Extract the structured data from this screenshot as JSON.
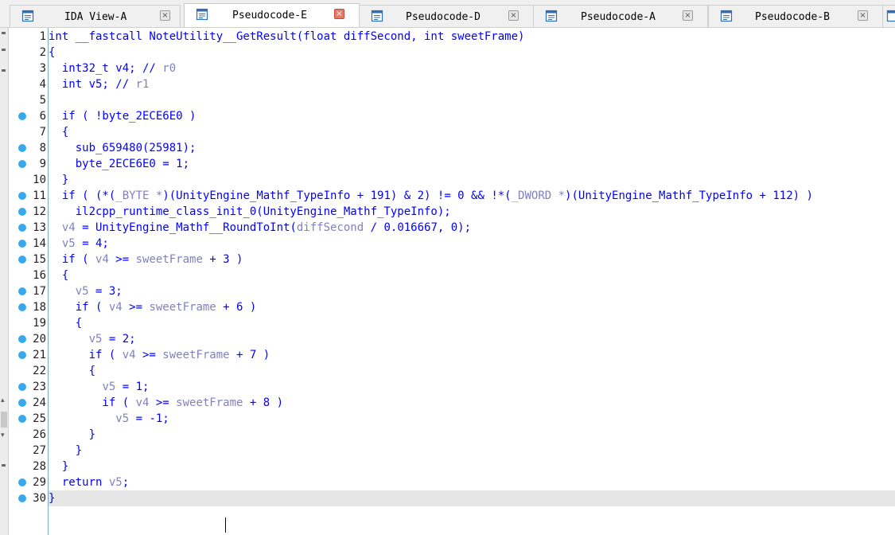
{
  "tabs": [
    {
      "label": "IDA View-A",
      "active": false,
      "close_glyph": "×",
      "icon": "ida-view-icon"
    },
    {
      "label": "Pseudocode-E",
      "active": true,
      "close_glyph": "×",
      "icon": "pseudocode-icon"
    },
    {
      "label": "Pseudocode-D",
      "active": false,
      "close_glyph": "×",
      "icon": "pseudocode-icon"
    },
    {
      "label": "Pseudocode-A",
      "active": false,
      "close_glyph": "×",
      "icon": "pseudocode-icon"
    },
    {
      "label": "Pseudocode-B",
      "active": false,
      "close_glyph": "×",
      "icon": "pseudocode-icon"
    }
  ],
  "colors": {
    "code_text": "#0000ff",
    "variable_gray": "#8080c0",
    "breakpoint_dot": "#35a9ee",
    "active_close": "#e87a6a",
    "current_line_bg": "#e6e6e6",
    "gutter_border": "#7aa9d6"
  },
  "code": {
    "current_line": 30,
    "lines": [
      {
        "n": "1",
        "bp": false,
        "tokens": [
          {
            "t": "int __fastcall NoteUtility__GetResult(float diffSecond, int sweetFrame)",
            "c": "t-k"
          }
        ]
      },
      {
        "n": "2",
        "bp": false,
        "tokens": [
          {
            "t": "{",
            "c": "t-k"
          }
        ]
      },
      {
        "n": "3",
        "bp": false,
        "tokens": [
          {
            "t": "  int32_t v4; // ",
            "c": "t-b"
          },
          {
            "t": "r0",
            "c": "t-g"
          }
        ]
      },
      {
        "n": "4",
        "bp": false,
        "tokens": [
          {
            "t": "  int v5; // ",
            "c": "t-b"
          },
          {
            "t": "r1",
            "c": "t-g"
          }
        ]
      },
      {
        "n": "5",
        "bp": false,
        "tokens": [
          {
            "t": "",
            "c": "t-b"
          }
        ]
      },
      {
        "n": "6",
        "bp": true,
        "tokens": [
          {
            "t": "  if ( !byte_2ECE6E0 )",
            "c": "t-b"
          }
        ]
      },
      {
        "n": "7",
        "bp": false,
        "tokens": [
          {
            "t": "  {",
            "c": "t-b"
          }
        ]
      },
      {
        "n": "8",
        "bp": true,
        "tokens": [
          {
            "t": "    sub_659480(25981);",
            "c": "t-b"
          }
        ]
      },
      {
        "n": "9",
        "bp": true,
        "tokens": [
          {
            "t": "    byte_2ECE6E0 = 1;",
            "c": "t-b"
          }
        ]
      },
      {
        "n": "10",
        "bp": false,
        "tokens": [
          {
            "t": "  }",
            "c": "t-b"
          }
        ]
      },
      {
        "n": "11",
        "bp": true,
        "tokens": [
          {
            "t": "  if ( (*(",
            "c": "t-b"
          },
          {
            "t": "_BYTE *",
            "c": "t-g"
          },
          {
            "t": ")(UnityEngine_Mathf_TypeInfo + 191) & 2) != 0 && !*(",
            "c": "t-b"
          },
          {
            "t": "_DWORD *",
            "c": "t-g"
          },
          {
            "t": ")(UnityEngine_Mathf_TypeInfo + 112) )",
            "c": "t-b"
          }
        ]
      },
      {
        "n": "12",
        "bp": true,
        "tokens": [
          {
            "t": "    il2cpp_runtime_class_init_0(UnityEngine_Mathf_TypeInfo);",
            "c": "t-b"
          }
        ]
      },
      {
        "n": "13",
        "bp": true,
        "tokens": [
          {
            "t": "  ",
            "c": "t-b"
          },
          {
            "t": "v4",
            "c": "t-g"
          },
          {
            "t": " = UnityEngine_Mathf__RoundToInt(",
            "c": "t-b"
          },
          {
            "t": "diffSecond",
            "c": "t-g"
          },
          {
            "t": " / 0.016667, 0);",
            "c": "t-b"
          }
        ]
      },
      {
        "n": "14",
        "bp": true,
        "tokens": [
          {
            "t": "  ",
            "c": "t-b"
          },
          {
            "t": "v5",
            "c": "t-g"
          },
          {
            "t": " = 4;",
            "c": "t-b"
          }
        ]
      },
      {
        "n": "15",
        "bp": true,
        "tokens": [
          {
            "t": "  if ( ",
            "c": "t-b"
          },
          {
            "t": "v4",
            "c": "t-g"
          },
          {
            "t": " >= ",
            "c": "t-b"
          },
          {
            "t": "sweetFrame",
            "c": "t-g"
          },
          {
            "t": " + 3 )",
            "c": "t-b"
          }
        ]
      },
      {
        "n": "16",
        "bp": false,
        "tokens": [
          {
            "t": "  {",
            "c": "t-b"
          }
        ]
      },
      {
        "n": "17",
        "bp": true,
        "tokens": [
          {
            "t": "    ",
            "c": "t-b"
          },
          {
            "t": "v5",
            "c": "t-g"
          },
          {
            "t": " = 3;",
            "c": "t-b"
          }
        ]
      },
      {
        "n": "18",
        "bp": true,
        "tokens": [
          {
            "t": "    if ( ",
            "c": "t-b"
          },
          {
            "t": "v4",
            "c": "t-g"
          },
          {
            "t": " >= ",
            "c": "t-b"
          },
          {
            "t": "sweetFrame",
            "c": "t-g"
          },
          {
            "t": " + 6 )",
            "c": "t-b"
          }
        ]
      },
      {
        "n": "19",
        "bp": false,
        "tokens": [
          {
            "t": "    {",
            "c": "t-b"
          }
        ]
      },
      {
        "n": "20",
        "bp": true,
        "tokens": [
          {
            "t": "      ",
            "c": "t-b"
          },
          {
            "t": "v5",
            "c": "t-g"
          },
          {
            "t": " = 2;",
            "c": "t-b"
          }
        ]
      },
      {
        "n": "21",
        "bp": true,
        "tokens": [
          {
            "t": "      if ( ",
            "c": "t-b"
          },
          {
            "t": "v4",
            "c": "t-g"
          },
          {
            "t": " >= ",
            "c": "t-b"
          },
          {
            "t": "sweetFrame",
            "c": "t-g"
          },
          {
            "t": " + 7 )",
            "c": "t-b"
          }
        ]
      },
      {
        "n": "22",
        "bp": false,
        "tokens": [
          {
            "t": "      {",
            "c": "t-b"
          }
        ]
      },
      {
        "n": "23",
        "bp": true,
        "tokens": [
          {
            "t": "        ",
            "c": "t-b"
          },
          {
            "t": "v5",
            "c": "t-g"
          },
          {
            "t": " = 1;",
            "c": "t-b"
          }
        ]
      },
      {
        "n": "24",
        "bp": true,
        "tokens": [
          {
            "t": "        if ( ",
            "c": "t-b"
          },
          {
            "t": "v4",
            "c": "t-g"
          },
          {
            "t": " >= ",
            "c": "t-b"
          },
          {
            "t": "sweetFrame",
            "c": "t-g"
          },
          {
            "t": " + 8 )",
            "c": "t-b"
          }
        ]
      },
      {
        "n": "25",
        "bp": true,
        "tokens": [
          {
            "t": "          ",
            "c": "t-b"
          },
          {
            "t": "v5",
            "c": "t-g"
          },
          {
            "t": " = -1;",
            "c": "t-b"
          }
        ]
      },
      {
        "n": "26",
        "bp": false,
        "tokens": [
          {
            "t": "      }",
            "c": "t-b"
          }
        ]
      },
      {
        "n": "27",
        "bp": false,
        "tokens": [
          {
            "t": "    }",
            "c": "t-b"
          }
        ]
      },
      {
        "n": "28",
        "bp": false,
        "tokens": [
          {
            "t": "  }",
            "c": "t-b"
          }
        ]
      },
      {
        "n": "29",
        "bp": true,
        "tokens": [
          {
            "t": "  return ",
            "c": "t-b"
          },
          {
            "t": "v5",
            "c": "t-g"
          },
          {
            "t": ";",
            "c": "t-b"
          }
        ]
      },
      {
        "n": "30",
        "bp": true,
        "tokens": [
          {
            "t": "}",
            "c": "t-b"
          }
        ]
      }
    ]
  }
}
